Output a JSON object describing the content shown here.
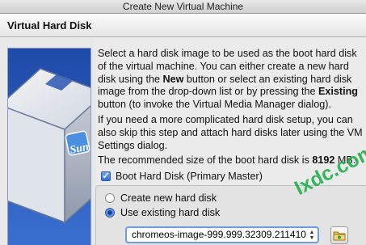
{
  "window": {
    "title": "Create New Virtual Machine"
  },
  "header": {
    "title": "Virtual Hard Disk"
  },
  "sidebar": {
    "logo_text": "Sun"
  },
  "content": {
    "p1_pre": "Select a hard disk image to be used as the boot hard disk of the virtual machine. You can either create a new hard disk using the ",
    "p1_new": "New",
    "p1_mid": " button or select an existing hard disk image from the drop-down list or by pressing the ",
    "p1_existing": "Existing",
    "p1_post": " button (to invoke the Virtual Media Manager dialog).",
    "p2": "If you need a more complicated hard disk setup, you can also skip this step and attach hard disks later using the VM Settings dialog.",
    "p3_pre": "The recommended size of the boot hard disk is ",
    "p3_size": "8192",
    "p3_post": " MB.",
    "boot_checkbox_label": "Boot Hard Disk (Primary Master)",
    "boot_checked": true,
    "radio_create_label": "Create new hard disk",
    "radio_existing_label": "Use existing hard disk",
    "selected_option": "existing",
    "combo_value": "chromeos-image-999.999.32309.211410"
  },
  "watermark": {
    "text": "Ixdc.com",
    "color": "#22b14c"
  },
  "icons": {
    "checkbox": "checkmark-icon",
    "combo": "up-down-arrows-icon",
    "folder": "folder-icon"
  }
}
